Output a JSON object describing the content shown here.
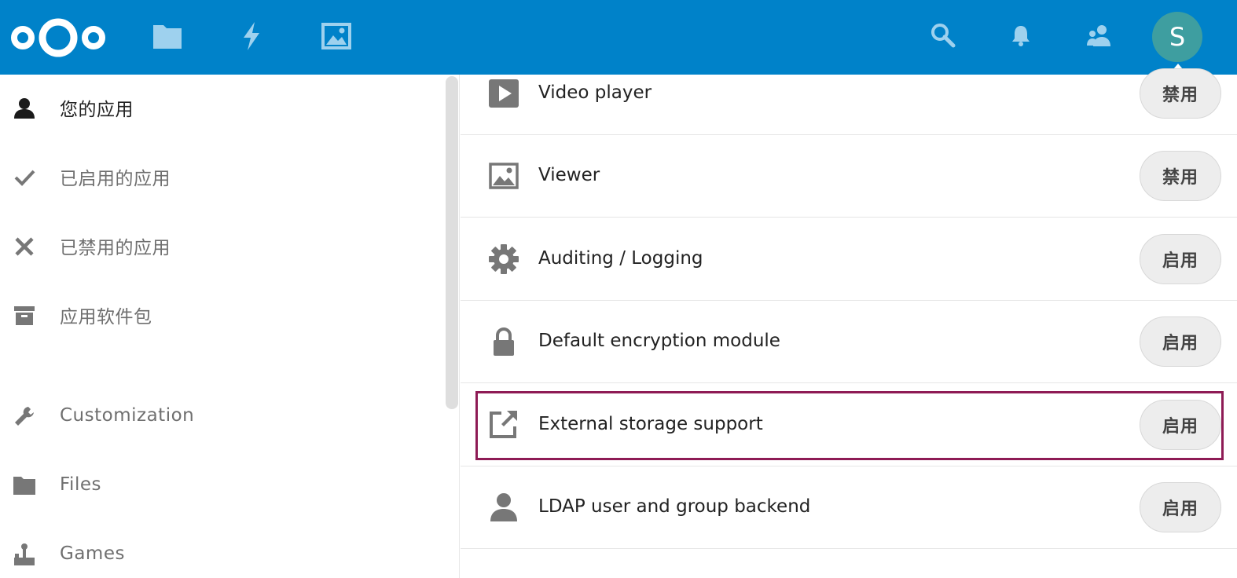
{
  "header": {
    "brand_color": "#0082c9",
    "nav": [
      {
        "icon": "folder-icon",
        "label": "Files"
      },
      {
        "icon": "lightning-icon",
        "label": "Activity"
      },
      {
        "icon": "image-icon",
        "label": "Photos"
      }
    ],
    "right_icons": [
      "search-icon",
      "bell-icon",
      "contacts-icon"
    ],
    "avatar_initial": "S",
    "avatar_color": "#3e9ea0"
  },
  "sidebar": {
    "items": [
      {
        "label": "您的应用",
        "icon": "user-icon",
        "active": true
      },
      {
        "label": "已启用的应用",
        "icon": "check-icon"
      },
      {
        "label": "已禁用的应用",
        "icon": "close-icon"
      },
      {
        "label": "应用软件包",
        "icon": "archive-icon"
      },
      {
        "label": "Customization",
        "icon": "wrench-icon"
      },
      {
        "label": "Files",
        "icon": "folder-icon"
      },
      {
        "label": "Games",
        "icon": "joystick-icon"
      }
    ]
  },
  "apps": [
    {
      "name": "Video player",
      "icon": "play-icon",
      "button": "禁用"
    },
    {
      "name": "Viewer",
      "icon": "image-icon",
      "button": "禁用"
    },
    {
      "name": "Auditing / Logging",
      "icon": "gear-icon",
      "button": "启用"
    },
    {
      "name": "Default encryption module",
      "icon": "lock-icon",
      "button": "启用"
    },
    {
      "name": "External storage support",
      "icon": "external-link-icon",
      "button": "启用",
      "highlighted": true
    },
    {
      "name": "LDAP user and group backend",
      "icon": "user-icon",
      "button": "启用"
    }
  ],
  "highlight_color": "#8e1b55"
}
